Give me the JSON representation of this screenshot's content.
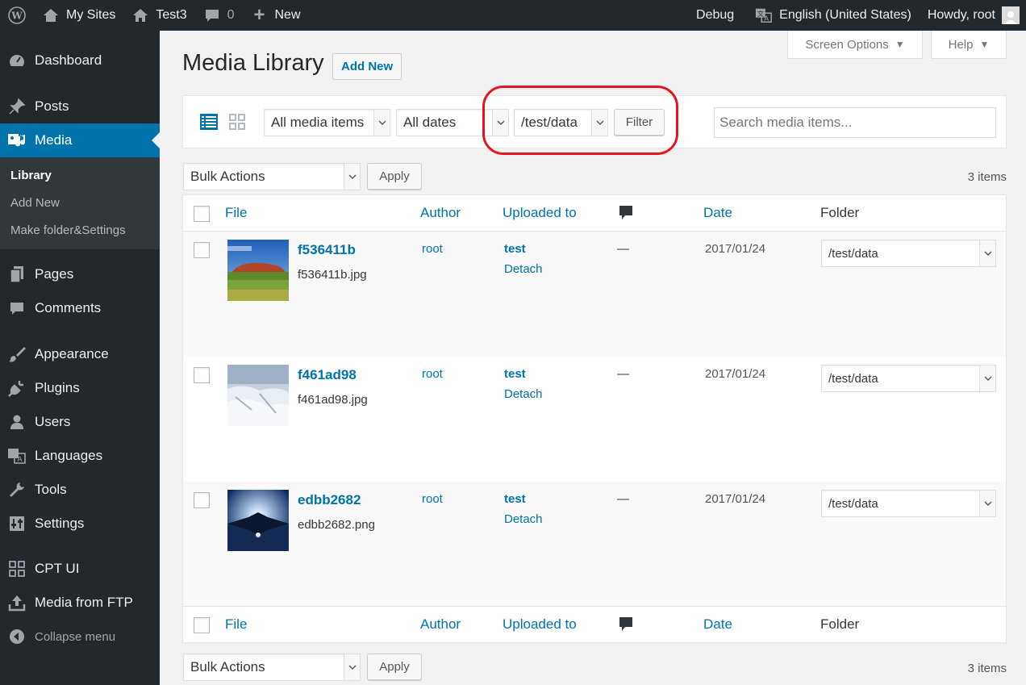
{
  "adminbar": {
    "my_sites": "My Sites",
    "site_name": "Test3",
    "comments_count": "0",
    "new_label": "New",
    "debug": "Debug",
    "language": "English (United States)",
    "howdy": "Howdy, root"
  },
  "sidebar": {
    "dashboard": "Dashboard",
    "posts": "Posts",
    "media": "Media",
    "submenu": [
      "Library",
      "Add New",
      "Make folder&Settings"
    ],
    "pages": "Pages",
    "comments": "Comments",
    "appearance": "Appearance",
    "plugins": "Plugins",
    "users": "Users",
    "languages": "Languages",
    "tools": "Tools",
    "settings": "Settings",
    "cpt_ui": "CPT UI",
    "media_ftp": "Media from FTP",
    "collapse": "Collapse menu"
  },
  "header": {
    "screen_options": "Screen Options",
    "help": "Help",
    "title": "Media Library",
    "add_new": "Add New"
  },
  "filters": {
    "media_type": "All media items",
    "dates": "All dates",
    "folder": "/test/data",
    "filter_button": "Filter",
    "search_placeholder": "Search media items..."
  },
  "bulk": {
    "label": "Bulk Actions",
    "apply": "Apply",
    "count": "3 items"
  },
  "columns": {
    "file": "File",
    "author": "Author",
    "uploaded_to": "Uploaded to",
    "date": "Date",
    "folder": "Folder"
  },
  "rows": [
    {
      "title": "f536411b",
      "filename": "f536411b.jpg",
      "author": "root",
      "uploaded_to": "test",
      "detach": "Detach",
      "comments": "—",
      "date": "2017/01/24",
      "folder": "/test/data"
    },
    {
      "title": "f461ad98",
      "filename": "f461ad98.jpg",
      "author": "root",
      "uploaded_to": "test",
      "detach": "Detach",
      "comments": "—",
      "date": "2017/01/24",
      "folder": "/test/data"
    },
    {
      "title": "edbb2682",
      "filename": "edbb2682.png",
      "author": "root",
      "uploaded_to": "test",
      "detach": "Detach",
      "comments": "—",
      "date": "2017/01/24",
      "folder": "/test/data"
    }
  ],
  "colors": {
    "adminbar": "#23282d",
    "accent": "#0073aa",
    "highlight": "#e3161f"
  }
}
